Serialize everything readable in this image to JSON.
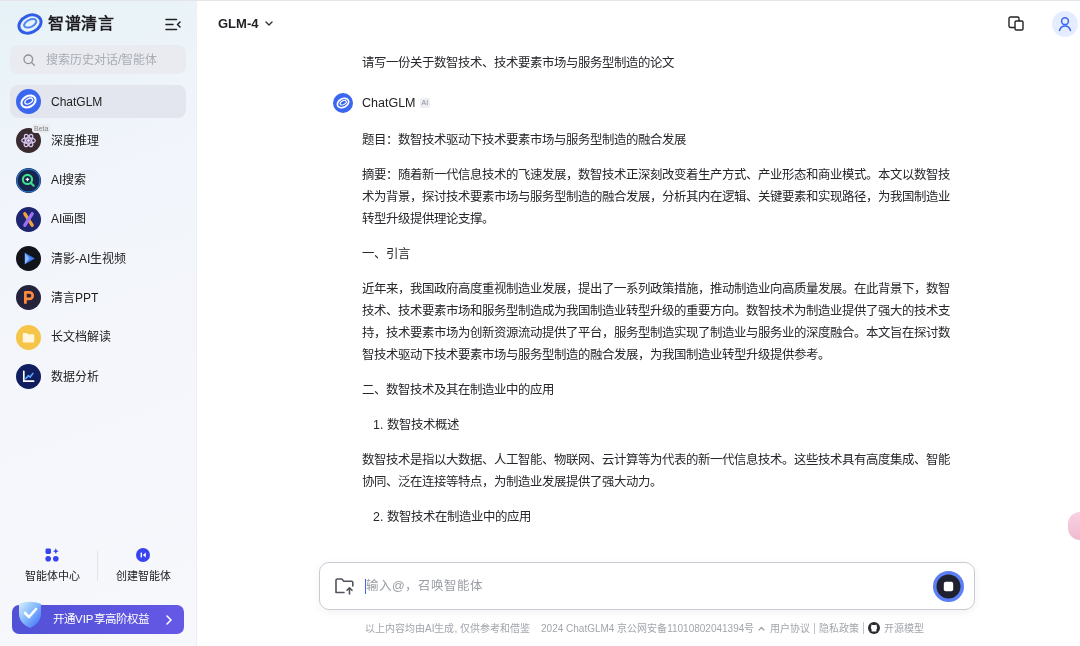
{
  "sidebar": {
    "logo": {
      "text": "智谱清言"
    },
    "search": {
      "placeholder": "搜索历史对话/智能体"
    },
    "items": [
      {
        "label": "ChatGLM",
        "kind": "chatglm",
        "selected": true
      },
      {
        "label": "深度推理",
        "kind": "reasoning",
        "selected": false,
        "badge": "Beta"
      },
      {
        "label": "AI搜索",
        "kind": "search",
        "selected": false
      },
      {
        "label": "AI画图",
        "kind": "paint",
        "selected": false
      },
      {
        "label": "清影-AI生视频",
        "kind": "video",
        "selected": false
      },
      {
        "label": "清言PPT",
        "kind": "ppt",
        "selected": false
      },
      {
        "label": "长文档解读",
        "kind": "document",
        "selected": false
      },
      {
        "label": "数据分析",
        "kind": "analysis",
        "selected": false
      }
    ],
    "actions": [
      {
        "label": "智能体中心",
        "kind": "agents"
      },
      {
        "label": "创建智能体",
        "kind": "create"
      }
    ],
    "vip_button": {
      "label": "开通VIP享高阶权益"
    }
  },
  "header": {
    "model": "GLM-4"
  },
  "chat": {
    "user_message": "请写一份关于数智技术、技术要素市场与服务型制造的论文",
    "assistant": {
      "name": "ChatGLM",
      "badge": "AI"
    },
    "paragraphs": [
      {
        "kind": "text",
        "text": "题目：数智技术驱动下技术要素市场与服务型制造的融合发展"
      },
      {
        "kind": "text",
        "text": "摘要：随着新一代信息技术的飞速发展，数智技术正深刻改变着生产方式、产业形态和商业模式。本文以数智技术为背景，探讨技术要素市场与服务型制造的融合发展，分析其内在逻辑、关键要素和实现路径，为我国制造业转型升级提供理论支撑。"
      },
      {
        "kind": "text",
        "text": "一、引言"
      },
      {
        "kind": "text",
        "text": "近年来，我国政府高度重视制造业发展，提出了一系列政策措施，推动制造业向高质量发展。在此背景下，数智技术、技术要素市场和服务型制造成为我国制造业转型升级的重要方向。数智技术为制造业提供了强大的技术支持，技术要素市场为创新资源流动提供了平台，服务型制造实现了制造业与服务业的深度融合。本文旨在探讨数智技术驱动下技术要素市场与服务型制造的融合发展，为我国制造业转型升级提供参考。"
      },
      {
        "kind": "text",
        "text": "二、数智技术及其在制造业中的应用"
      },
      {
        "kind": "list_item",
        "text": "1. 数智技术概述"
      },
      {
        "kind": "text",
        "text": "数智技术是指以大数据、人工智能、物联网、云计算等为代表的新一代信息技术。这些技术具有高度集成、智能协同、泛在连接等特点，为制造业发展提供了强大动力。"
      },
      {
        "kind": "list_item",
        "text": "2. 数智技术在制造业中的应用"
      }
    ]
  },
  "composer": {
    "placeholder": "输入@，召唤智能体"
  },
  "footer": {
    "disclaimer": "以上内容均由AI生成, 仅供参考和借鉴",
    "copyright": "2024 ChatGLM4 京公网安备11010802041394号",
    "links": [
      {
        "label": "用户协议",
        "kind": "plain"
      },
      {
        "label": "隐私政策",
        "kind": "plain"
      },
      {
        "label": "开源模型",
        "kind": "github"
      }
    ]
  }
}
